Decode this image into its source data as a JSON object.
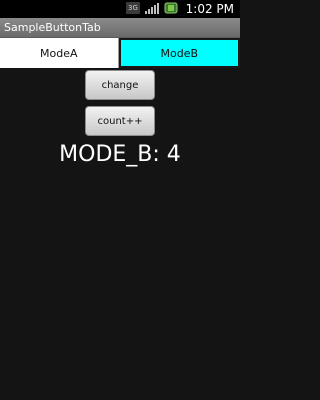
{
  "status_bar": {
    "time": "1:02 PM",
    "network_label": "3G",
    "icons": [
      "3g-icon",
      "signal-icon",
      "battery-icon"
    ]
  },
  "app": {
    "title": "SampleButtonTab"
  },
  "tabs": [
    {
      "label": "ModeA",
      "selected": false
    },
    {
      "label": "ModeB",
      "selected": true
    }
  ],
  "buttons": {
    "change_label": "change",
    "count_label": "count++"
  },
  "display": {
    "mode_text": "MODE_B: 4"
  },
  "colors": {
    "background": "#141414",
    "selected_tab": "#00ffff",
    "unselected_tab": "#ffffff"
  }
}
